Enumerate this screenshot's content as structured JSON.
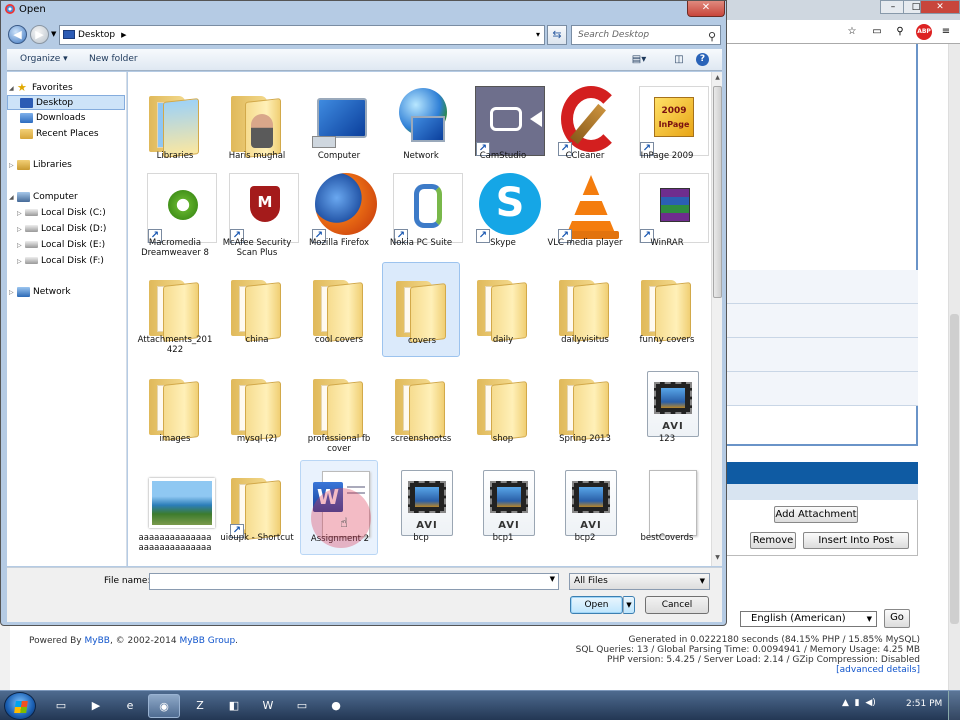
{
  "dialog": {
    "title": "Open",
    "close_label": "✕",
    "address_path": "Desktop",
    "search_placeholder": "Search Desktop",
    "toolbar": {
      "organize": "Organize ▾",
      "new_folder": "New folder"
    },
    "nav": {
      "favorites": "Favorites",
      "desktop": "Desktop",
      "downloads": "Downloads",
      "recent_places": "Recent Places",
      "libraries": "Libraries",
      "computer": "Computer",
      "local_c": "Local Disk (C:)",
      "local_d": "Local Disk (D:)",
      "local_e": "Local Disk (E:)",
      "local_f": "Local Disk (F:)",
      "network": "Network"
    },
    "items": [
      {
        "label": "Libraries",
        "kind": "libraries"
      },
      {
        "label": "Haris mughal",
        "kind": "user"
      },
      {
        "label": "Computer",
        "kind": "computer"
      },
      {
        "label": "Network",
        "kind": "network"
      },
      {
        "label": "CamStudio",
        "kind": "camstudio",
        "shortcut": true
      },
      {
        "label": "CCleaner",
        "kind": "ccleaner",
        "shortcut": true
      },
      {
        "label": "InPage 2009",
        "kind": "inpage",
        "shortcut": true
      },
      {
        "label": "Macromedia Dreamweaver 8",
        "kind": "dreamweaver",
        "shortcut": true
      },
      {
        "label": "McAfee Security Scan Plus",
        "kind": "mcafee",
        "shortcut": true
      },
      {
        "label": "Mozilla Firefox",
        "kind": "firefox",
        "shortcut": true
      },
      {
        "label": "Nokia PC Suite",
        "kind": "nokia",
        "shortcut": true
      },
      {
        "label": "Skype",
        "kind": "skype",
        "shortcut": true
      },
      {
        "label": "VLC media player",
        "kind": "vlc",
        "shortcut": true
      },
      {
        "label": "WinRAR",
        "kind": "winrar",
        "shortcut": true
      },
      {
        "label": "Attachments_201 422",
        "kind": "folder"
      },
      {
        "label": "china",
        "kind": "folder"
      },
      {
        "label": "cool covers",
        "kind": "folder"
      },
      {
        "label": "covers",
        "kind": "folder",
        "selected": true
      },
      {
        "label": "daily",
        "kind": "folder"
      },
      {
        "label": "dailyvisitus",
        "kind": "folder"
      },
      {
        "label": "funny covers",
        "kind": "folder"
      },
      {
        "label": "images",
        "kind": "folder"
      },
      {
        "label": "mysql (2)",
        "kind": "folder"
      },
      {
        "label": "professional fb cover",
        "kind": "folder"
      },
      {
        "label": "screenshootss",
        "kind": "folder"
      },
      {
        "label": "shop",
        "kind": "folder"
      },
      {
        "label": "Spring 2013",
        "kind": "folder"
      },
      {
        "label": "123",
        "kind": "avi"
      },
      {
        "label": "aaaaaaaaaaaaaa aaaaaaaaaaaaaa",
        "kind": "image"
      },
      {
        "label": "uioupk - Shortcut",
        "kind": "folder",
        "shortcut": true
      },
      {
        "label": "Assignment 2",
        "kind": "word",
        "hover": true
      },
      {
        "label": "bcp",
        "kind": "avi"
      },
      {
        "label": "bcp1",
        "kind": "avi"
      },
      {
        "label": "bcp2",
        "kind": "avi"
      },
      {
        "label": "bestCoverds",
        "kind": "blank"
      }
    ],
    "file_name_label": "File name:",
    "file_name_value": "",
    "file_type": "All Files",
    "open_label": "Open",
    "cancel_label": "Cancel"
  },
  "background": {
    "buttons": {
      "add_attachment": "Add Attachment",
      "remove": "Remove",
      "insert_into_post": "Insert Into Post",
      "go": "Go"
    },
    "language": "English (American)",
    "footer_left": {
      "prefix": "Powered By ",
      "mybb": "MyBB",
      "mid": ", © 2002-2014 ",
      "group": "MyBB Group",
      "suffix": "."
    },
    "footer_right": {
      "line1": "Generated in 0.0222180 seconds (84.15% PHP / 15.85% MySQL)",
      "line2": "SQL Queries: 13 / Global Parsing Time: 0.0094941 / Memory Usage: 4.25 MB",
      "line3": "PHP version: 5.4.25 / Server Load: 2.14 / GZip Compression: Disabled",
      "advanced": "[advanced details]"
    }
  },
  "taskbar": {
    "clock": "2:51 PM"
  }
}
